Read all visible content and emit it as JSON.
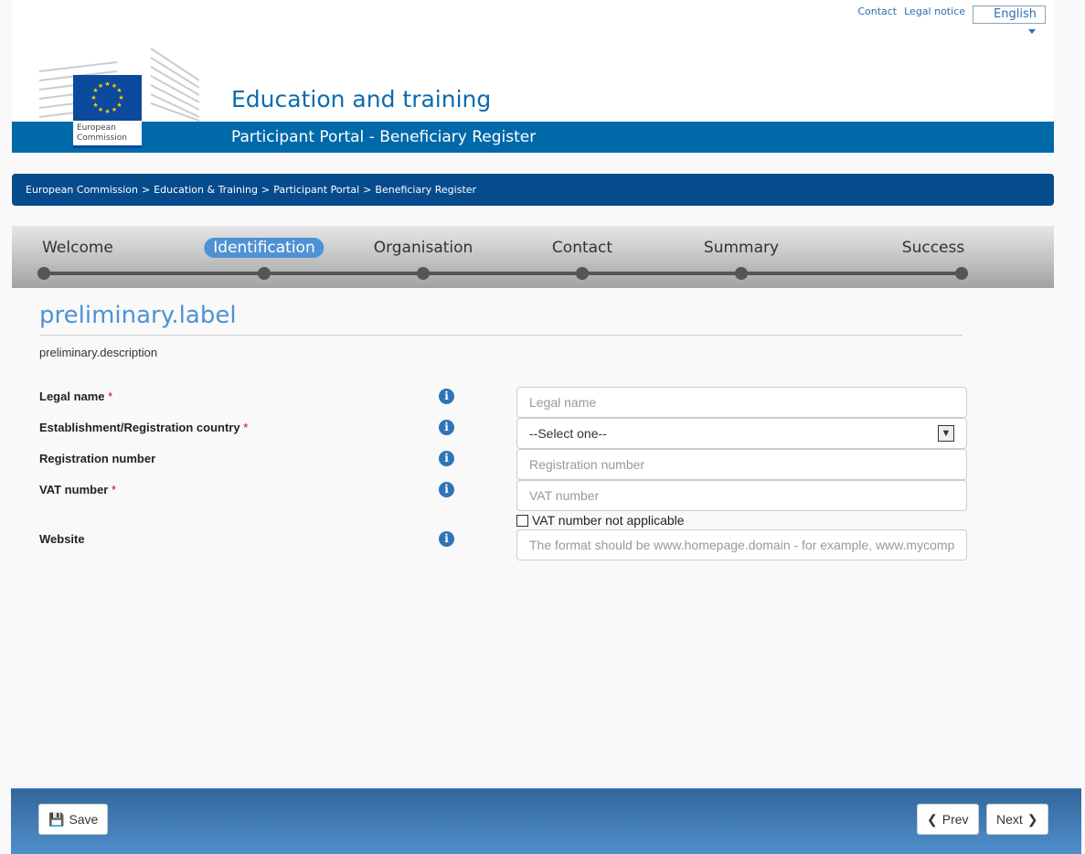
{
  "top_links": {
    "contact": "Contact",
    "legal": "Legal notice",
    "language": "English"
  },
  "logo": {
    "text": "European Commission"
  },
  "header": {
    "title": "Education and training",
    "subtitle": "Participant Portal - Beneficiary Register"
  },
  "breadcrumb": [
    "European Commission",
    "Education & Training",
    "Participant Portal",
    "Beneficiary Register"
  ],
  "steps": [
    {
      "label": "Welcome"
    },
    {
      "label": "Identification",
      "active": true
    },
    {
      "label": "Organisation"
    },
    {
      "label": "Contact"
    },
    {
      "label": "Summary"
    },
    {
      "label": "Success"
    }
  ],
  "form": {
    "title": "preliminary.label",
    "description": "preliminary.description",
    "fields": [
      {
        "label": "Legal name",
        "required": "*",
        "placeholder": "Legal name"
      },
      {
        "label": "Establishment/Registration country",
        "required": "*",
        "value": "--Select one--"
      },
      {
        "label": "Registration number",
        "placeholder": "Registration number"
      },
      {
        "label": "VAT number",
        "required": "*",
        "placeholder": "VAT number"
      },
      {
        "label": "Website",
        "placeholder": "The format should be www.homepage.domain - for example, www.mycompany.com"
      }
    ],
    "vat_checkbox": "VAT number not applicable"
  },
  "footer": {
    "save": "Save",
    "prev": "Prev",
    "next": "Next"
  },
  "colors": {
    "brand": "#0069aa",
    "breadcrumb": "#064c8c",
    "active_step": "#4f92d4"
  }
}
